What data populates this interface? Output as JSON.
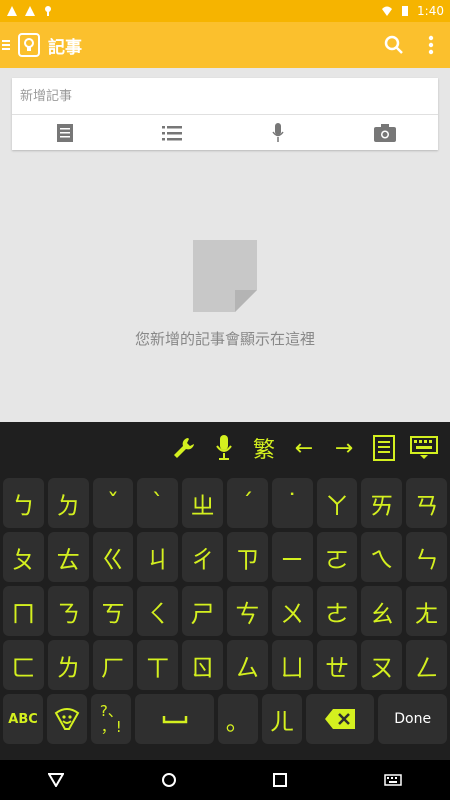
{
  "status": {
    "time": "1:40"
  },
  "app": {
    "title": "記事"
  },
  "note": {
    "placeholder": "新增記事"
  },
  "empty_state": {
    "message": "您新增的記事會顯示在這裡"
  },
  "keyboard": {
    "toolbar": {
      "trad": "繁",
      "left": "←",
      "right": "→"
    },
    "row1": [
      "ㄅ",
      "ㄉ",
      "ˇ",
      "ˋ",
      "ㄓ",
      "ˊ",
      "˙",
      "ㄚ",
      "ㄞ",
      "ㄢ"
    ],
    "row2": [
      "ㄆ",
      "ㄊ",
      "ㄍ",
      "ㄐ",
      "ㄔ",
      "ㄗ",
      "ㄧ",
      "ㄛ",
      "ㄟ",
      "ㄣ"
    ],
    "row3": [
      "ㄇ",
      "ㄋ",
      "ㄎ",
      "ㄑ",
      "ㄕ",
      "ㄘ",
      "ㄨ",
      "ㄜ",
      "ㄠ",
      "ㄤ"
    ],
    "row4": [
      "ㄈ",
      "ㄌ",
      "ㄏ",
      "ㄒ",
      "ㄖ",
      "ㄙ",
      "ㄩ",
      "ㄝ",
      "ㄡ",
      "ㄥ"
    ],
    "row5": {
      "abc": "ABC",
      "punct": "?、\n，!",
      "dot": "。",
      "er": "ㄦ",
      "done": "Done"
    },
    "accent_color": "#d4f01f"
  },
  "colors": {
    "appbar": "#fbc02d",
    "statusbar": "#f6b400",
    "keyboard_bg": "#1f1f1f",
    "key_bg": "#2f2f2f"
  }
}
